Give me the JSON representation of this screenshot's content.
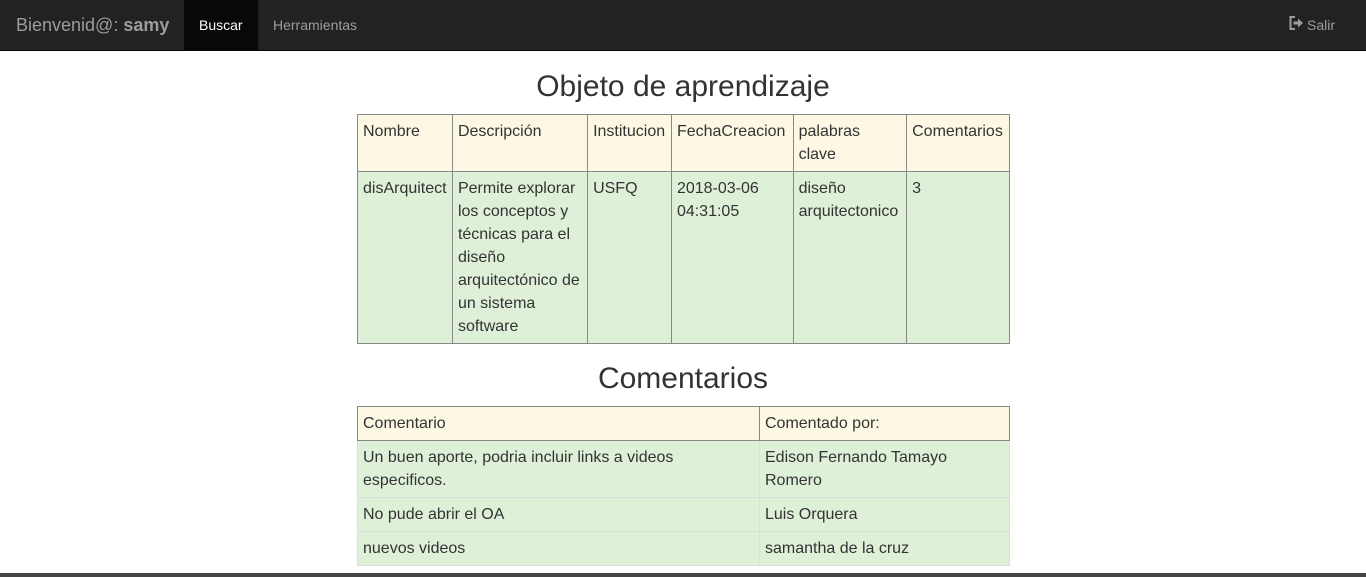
{
  "navbar": {
    "brand_prefix": "Bienvenid@: ",
    "brand_user": "samy",
    "items": [
      {
        "label": "Buscar"
      },
      {
        "label": "Herramientas"
      }
    ],
    "logout_label": "Salir",
    "logout_icon": "logout-icon"
  },
  "object_section": {
    "title": "Objeto de aprendizaje",
    "headers": [
      "Nombre",
      "Descripción",
      "Institucion",
      "FechaCreacion",
      "palabras clave",
      "Comentarios"
    ],
    "row": [
      "disArquitect",
      "Permite explorar los conceptos y técnicas para el diseño arquitectónico de un sistema software",
      "USFQ",
      "2018-03-06 04:31:05",
      "diseño arquitectonico",
      "3"
    ]
  },
  "comments_section": {
    "title": "Comentarios",
    "headers": [
      "Comentario",
      "Comentado por:"
    ],
    "rows": [
      [
        "Un buen aporte, podria incluir links a videos especificos.",
        "Edison Fernando Tamayo Romero"
      ],
      [
        "No pude abrir el OA",
        "Luis Orquera"
      ],
      [
        "nuevos videos",
        "samantha de la cruz"
      ]
    ]
  },
  "colors": {
    "navbar_bg": "#222222",
    "header_row": "#fcf8e3",
    "data_row": "#dff0d8"
  }
}
